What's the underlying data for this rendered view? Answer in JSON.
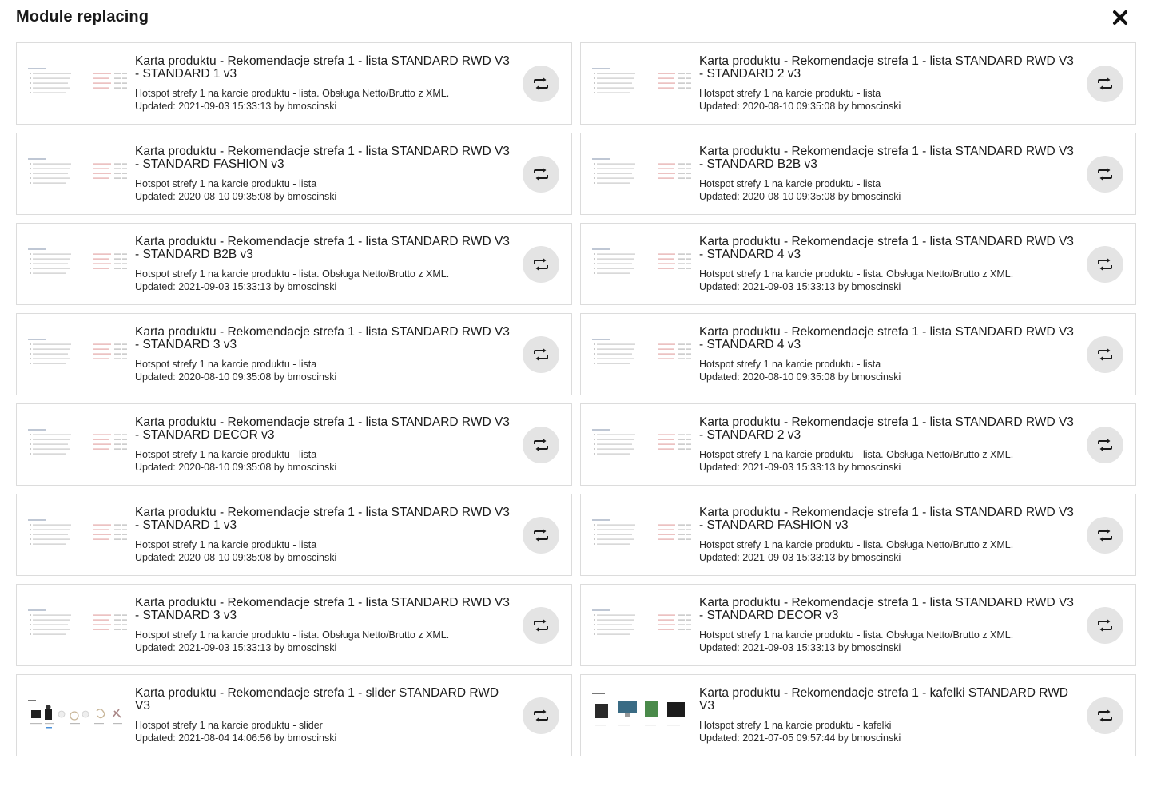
{
  "modal": {
    "title": "Module replacing",
    "close_icon": "close-icon"
  },
  "modules": [
    {
      "title": "Karta produktu - Rekomendacje strefa 1 - lista STANDARD RWD V3 - STANDARD 1 v3",
      "description": "Hotspot strefy 1 na karcie produktu - lista. Obsługa Netto/Brutto z XML.",
      "updated": "Updated: 2021-09-03 15:33:13 by bmoscinski",
      "thumbnail": "list"
    },
    {
      "title": "Karta produktu - Rekomendacje strefa 1 - lista STANDARD RWD V3 - STANDARD 2 v3",
      "description": "Hotspot strefy 1 na karcie produktu - lista",
      "updated": "Updated: 2020-08-10 09:35:08 by bmoscinski",
      "thumbnail": "list"
    },
    {
      "title": "Karta produktu - Rekomendacje strefa 1 - lista STANDARD RWD V3 - STANDARD FASHION v3",
      "description": "Hotspot strefy 1 na karcie produktu - lista",
      "updated": "Updated: 2020-08-10 09:35:08 by bmoscinski",
      "thumbnail": "list"
    },
    {
      "title": "Karta produktu - Rekomendacje strefa 1 - lista STANDARD RWD V3 - STANDARD B2B v3",
      "description": "Hotspot strefy 1 na karcie produktu - lista",
      "updated": "Updated: 2020-08-10 09:35:08 by bmoscinski",
      "thumbnail": "list"
    },
    {
      "title": "Karta produktu - Rekomendacje strefa 1 - lista STANDARD RWD V3 - STANDARD B2B v3",
      "description": "Hotspot strefy 1 na karcie produktu - lista. Obsługa Netto/Brutto z XML.",
      "updated": "Updated: 2021-09-03 15:33:13 by bmoscinski",
      "thumbnail": "list"
    },
    {
      "title": "Karta produktu - Rekomendacje strefa 1 - lista STANDARD RWD V3 - STANDARD 4 v3",
      "description": "Hotspot strefy 1 na karcie produktu - lista. Obsługa Netto/Brutto z XML.",
      "updated": "Updated: 2021-09-03 15:33:13 by bmoscinski",
      "thumbnail": "list"
    },
    {
      "title": "Karta produktu - Rekomendacje strefa 1 - lista STANDARD RWD V3 - STANDARD 3 v3",
      "description": "Hotspot strefy 1 na karcie produktu - lista",
      "updated": "Updated: 2020-08-10 09:35:08 by bmoscinski",
      "thumbnail": "list"
    },
    {
      "title": "Karta produktu - Rekomendacje strefa 1 - lista STANDARD RWD V3 - STANDARD 4 v3",
      "description": "Hotspot strefy 1 na karcie produktu - lista",
      "updated": "Updated: 2020-08-10 09:35:08 by bmoscinski",
      "thumbnail": "list"
    },
    {
      "title": "Karta produktu - Rekomendacje strefa 1 - lista STANDARD RWD V3 - STANDARD DECOR v3",
      "description": "Hotspot strefy 1 na karcie produktu - lista",
      "updated": "Updated: 2020-08-10 09:35:08 by bmoscinski",
      "thumbnail": "list"
    },
    {
      "title": "Karta produktu - Rekomendacje strefa 1 - lista STANDARD RWD V3 - STANDARD 2 v3",
      "description": "Hotspot strefy 1 na karcie produktu - lista. Obsługa Netto/Brutto z XML.",
      "updated": "Updated: 2021-09-03 15:33:13 by bmoscinski",
      "thumbnail": "list"
    },
    {
      "title": "Karta produktu - Rekomendacje strefa 1 - lista STANDARD RWD V3 - STANDARD 1 v3",
      "description": "Hotspot strefy 1 na karcie produktu - lista",
      "updated": "Updated: 2020-08-10 09:35:08 by bmoscinski",
      "thumbnail": "list"
    },
    {
      "title": "Karta produktu - Rekomendacje strefa 1 - lista STANDARD RWD V3 - STANDARD FASHION v3",
      "description": "Hotspot strefy 1 na karcie produktu - lista. Obsługa Netto/Brutto z XML.",
      "updated": "Updated: 2021-09-03 15:33:13 by bmoscinski",
      "thumbnail": "list"
    },
    {
      "title": "Karta produktu - Rekomendacje strefa 1 - lista STANDARD RWD V3 - STANDARD 3 v3",
      "description": "Hotspot strefy 1 na karcie produktu - lista. Obsługa Netto/Brutto z XML.",
      "updated": "Updated: 2021-09-03 15:33:13 by bmoscinski",
      "thumbnail": "list"
    },
    {
      "title": "Karta produktu - Rekomendacje strefa 1 - lista STANDARD RWD V3 - STANDARD DECOR v3",
      "description": "Hotspot strefy 1 na karcie produktu - lista. Obsługa Netto/Brutto z XML.",
      "updated": "Updated: 2021-09-03 15:33:13 by bmoscinski",
      "thumbnail": "list"
    },
    {
      "title": "Karta produktu - Rekomendacje strefa 1 - slider STANDARD RWD V3",
      "description": "Hotspot strefy 1 na karcie produktu - slider",
      "updated": "Updated: 2021-08-04 14:06:56 by bmoscinski",
      "thumbnail": "slider"
    },
    {
      "title": "Karta produktu - Rekomendacje strefa 1 - kafelki STANDARD RWD V3",
      "description": "Hotspot strefy 1 na karcie produktu - kafelki",
      "updated": "Updated: 2021-07-05 09:57:44 by bmoscinski",
      "thumbnail": "tiles"
    }
  ],
  "replace_button_icon": "replace-icon",
  "colors": {
    "card_border": "#dcdcdc",
    "button_bg": "#e4e4e4",
    "text": "#1b1b1b"
  }
}
